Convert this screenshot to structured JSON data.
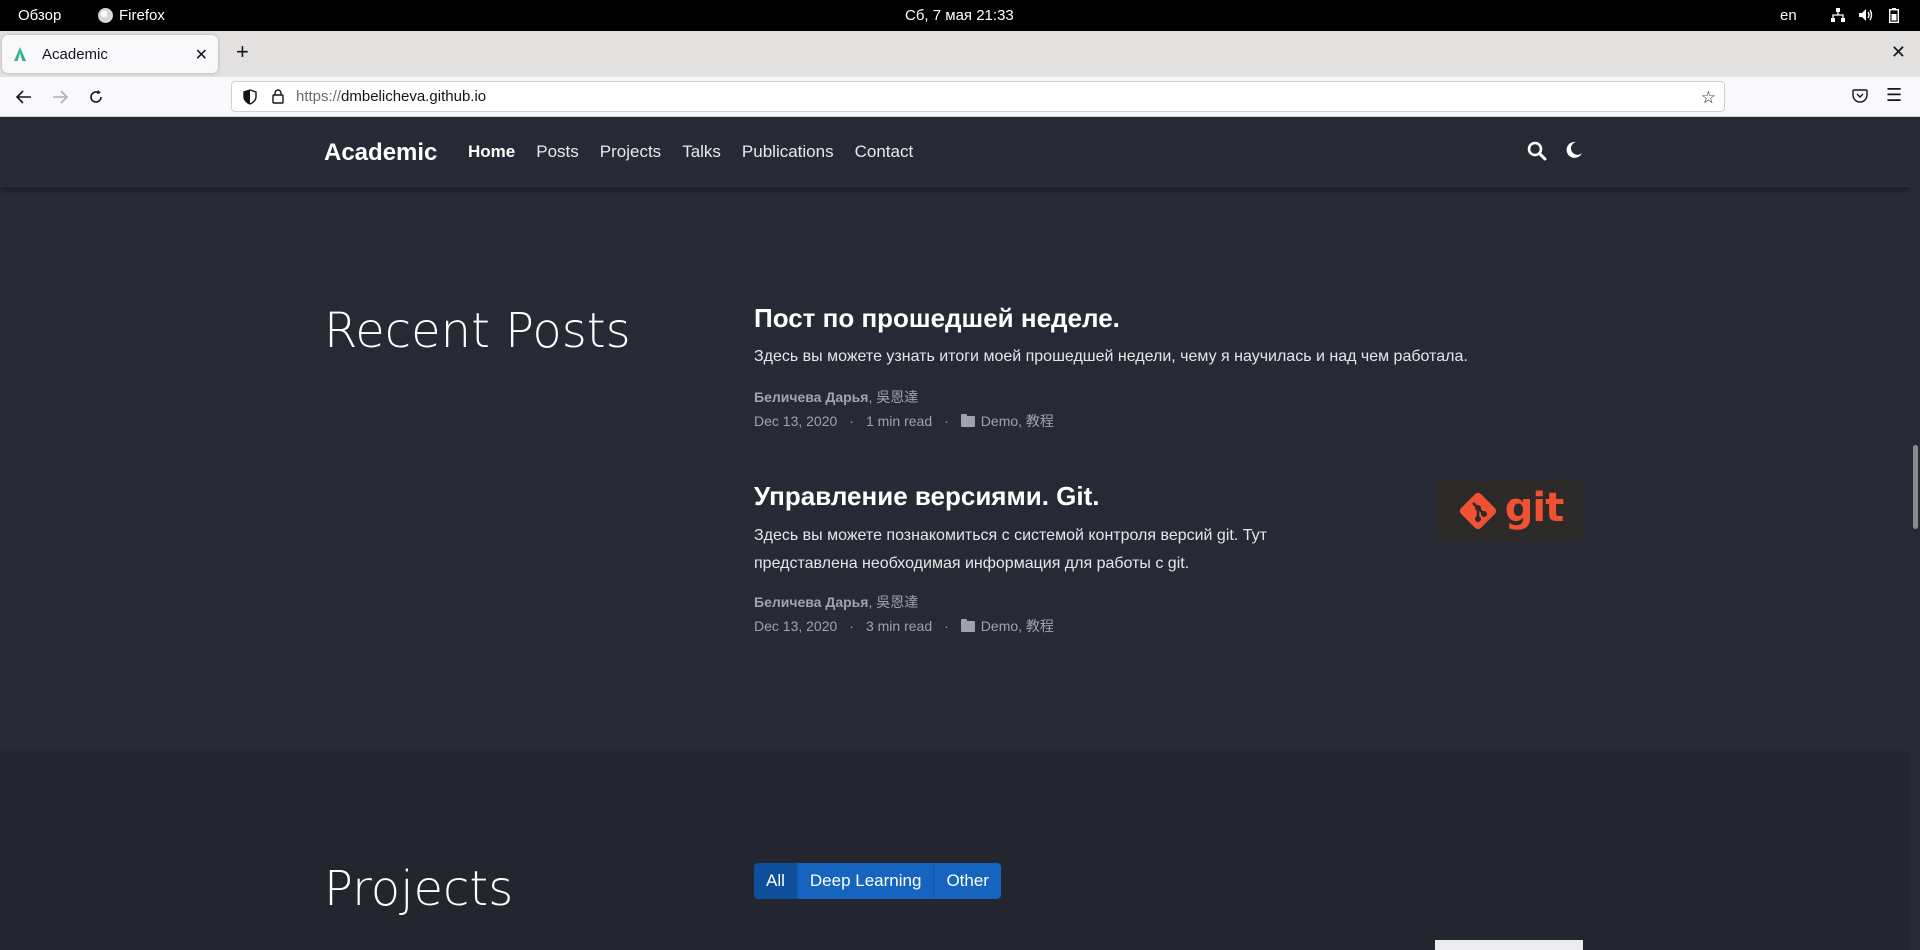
{
  "system_bar": {
    "activities": "Обзор",
    "app_name": "Firefox",
    "clock": "Сб, 7 мая  21:33",
    "lang": "en"
  },
  "browser": {
    "tab_title": "Academic",
    "url_scheme": "https://",
    "url_host": "dmbelicheva.github.io"
  },
  "site": {
    "brand": "Academic",
    "nav": [
      "Home",
      "Posts",
      "Projects",
      "Talks",
      "Publications",
      "Contact"
    ]
  },
  "recent_posts": {
    "heading": "Recent Posts",
    "posts": [
      {
        "title": "Пост по прошедшей неделе.",
        "summary": "Здесь вы можете узнать итоги моей прошедшей недели, чему я научилась и над чем работала.",
        "author_bold": "Беличева Дарья",
        "author_rest": ", 吳恩達",
        "date": "Dec 13, 2020",
        "read_time": "1 min read",
        "categories": "Demo, 教程"
      },
      {
        "title": "Управление версиями. Git.",
        "summary_line1": "Здесь вы можете познакомиться с системой контроля версий git. Тут",
        "summary_line2": "представлена необходимая информация для работы с git.",
        "author_bold": "Беличева Дарья",
        "author_rest": ", 吳恩達",
        "date": "Dec 13, 2020",
        "read_time": "3 min read",
        "categories": "Demo, 教程",
        "thumb_text": "git"
      }
    ]
  },
  "projects": {
    "heading": "Projects",
    "filters": [
      "All",
      "Deep Learning",
      "Other"
    ]
  },
  "colors": {
    "page_bg": "#272a35",
    "filter_blue": "#1565c0",
    "git_orange": "#f05133"
  }
}
